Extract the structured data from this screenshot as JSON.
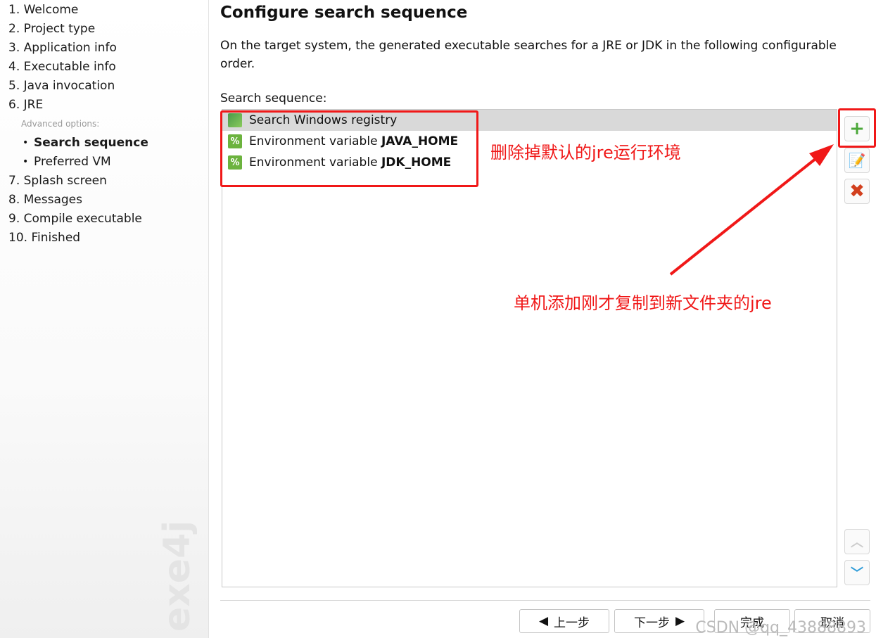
{
  "sidebar": {
    "steps": [
      "1. Welcome",
      "2. Project type",
      "3. Application info",
      "4. Executable info",
      "5. Java invocation",
      "6. JRE"
    ],
    "advanced_label": "Advanced options:",
    "sub_items": [
      "Search sequence",
      "Preferred VM"
    ],
    "steps2": [
      "7. Splash screen",
      "8. Messages",
      "9. Compile executable",
      "10. Finished"
    ],
    "brand": "exe4j"
  },
  "main": {
    "title": "Configure search sequence",
    "description": "On the target system, the generated executable searches for a JRE or JDK in the following configurable order.",
    "list_label": "Search sequence:",
    "items": [
      {
        "text": "Search Windows registry",
        "bold": ""
      },
      {
        "text": "Environment variable ",
        "bold": "JAVA_HOME"
      },
      {
        "text": "Environment variable ",
        "bold": "JDK_HOME"
      }
    ]
  },
  "nav": {
    "back": "上一步",
    "next": "下一步",
    "finish": "完成",
    "cancel": "取消"
  },
  "annotations": {
    "delete_note": "删除掉默认的jre运行环境",
    "add_note": "单机添加刚才复制到新文件夹的jre",
    "color": "#f01818"
  },
  "watermark": "CSDN @qq_43888893"
}
